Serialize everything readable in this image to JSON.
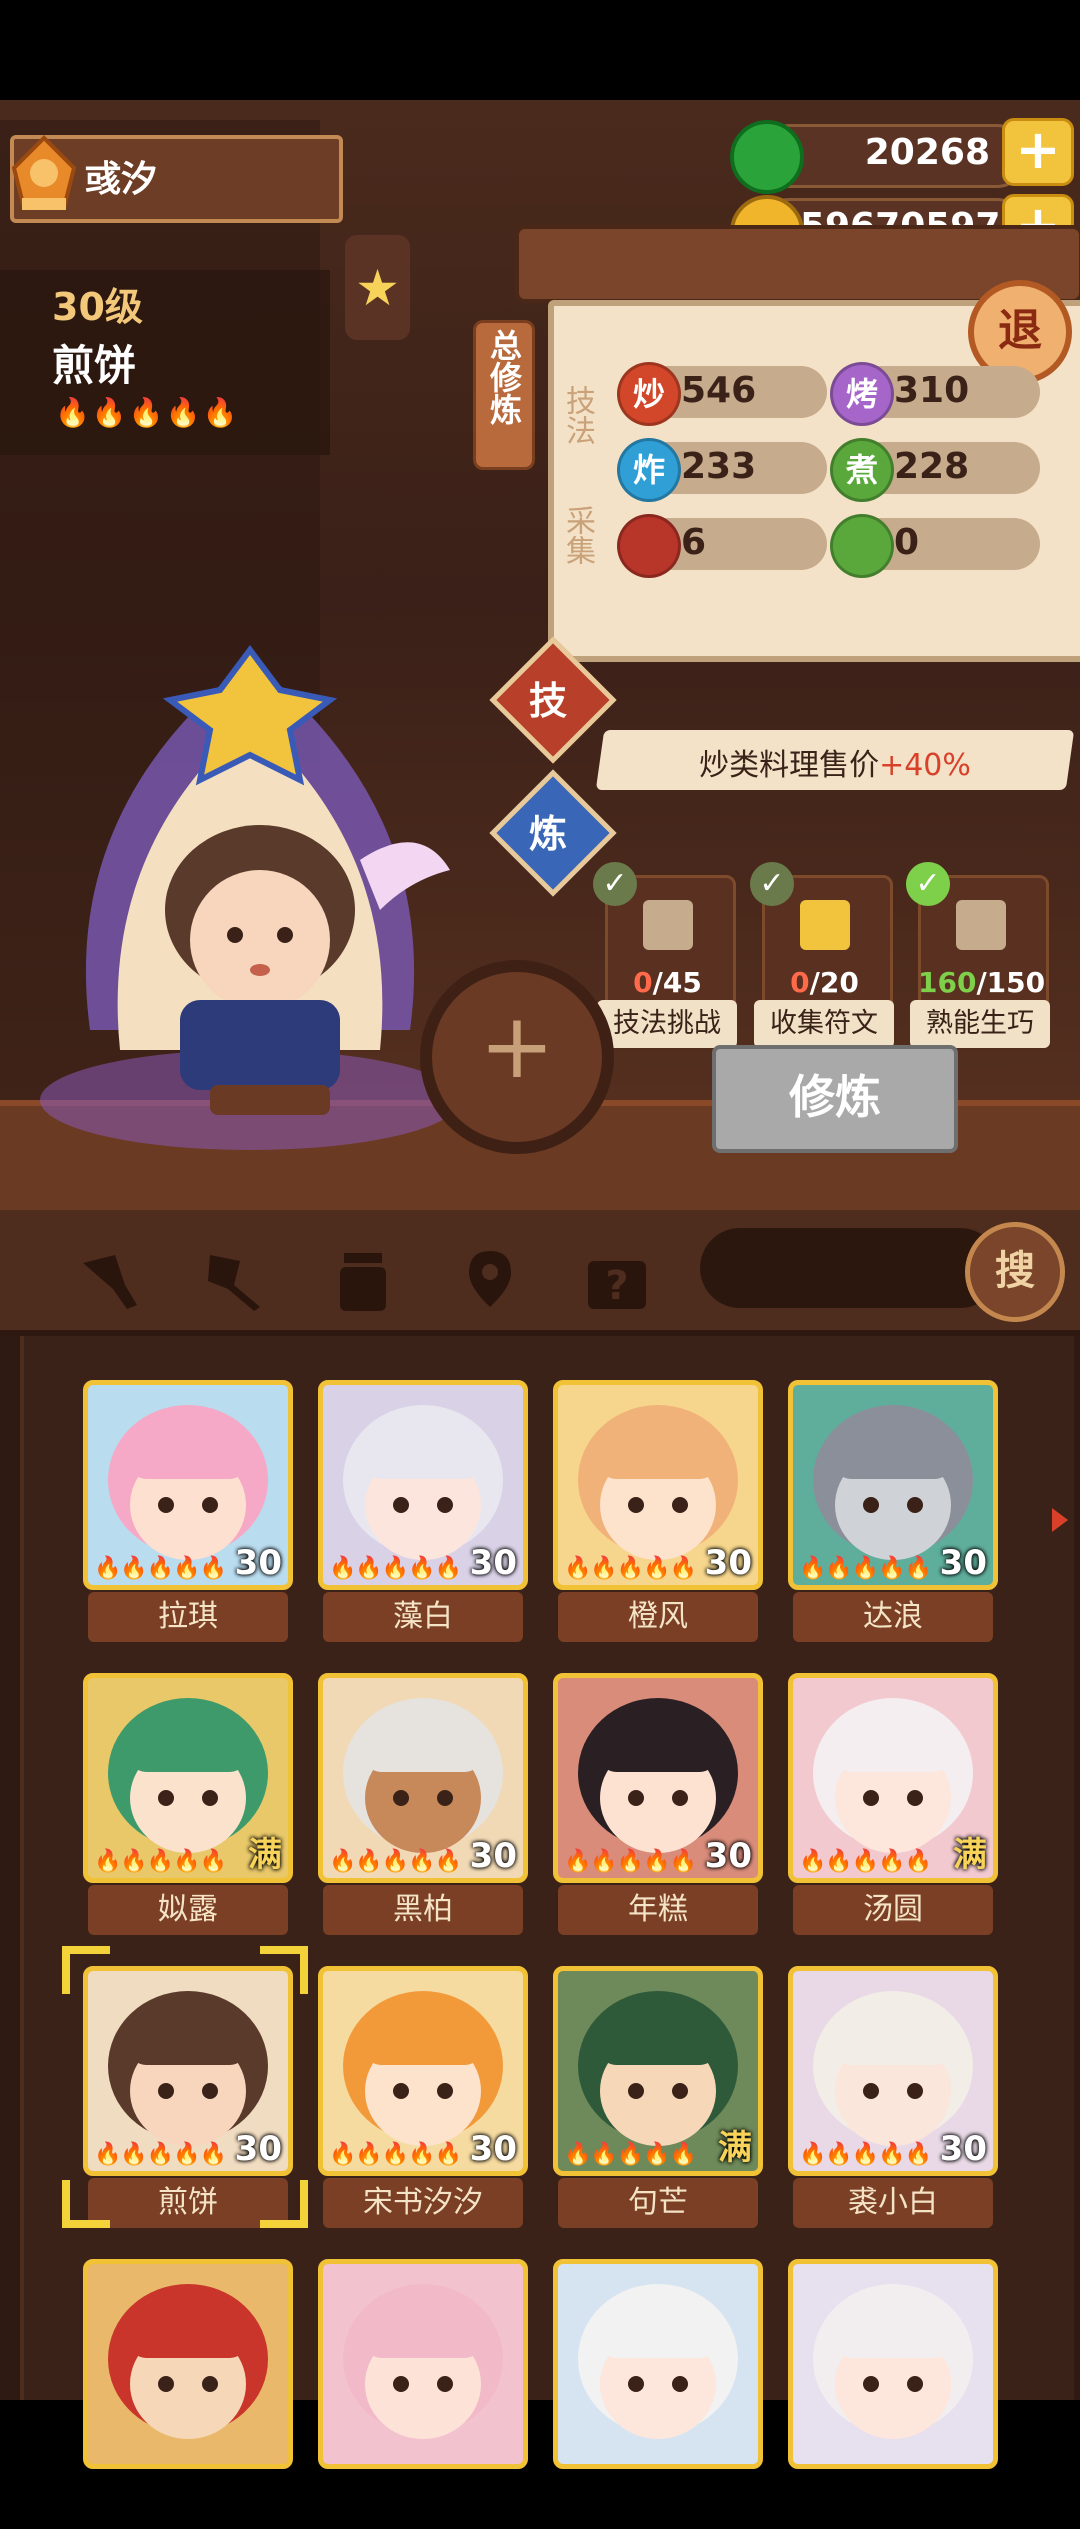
{
  "player": {
    "name": "彧汐"
  },
  "currency": {
    "jade": "20268",
    "coins": "59670597"
  },
  "chef": {
    "level": "30级",
    "name": "煎饼",
    "flames": "🔥🔥🔥🔥🔥"
  },
  "panel": {
    "sign": "总修炼",
    "technique_label": "技法",
    "gather_label": "采集",
    "stats": [
      {
        "icon": "炒",
        "value": "546",
        "color": "#d2472a"
      },
      {
        "icon": "烤",
        "value": "310",
        "color": "#a565c9"
      },
      {
        "icon": "炸",
        "value": "233",
        "color": "#2f9fd6"
      },
      {
        "icon": "煮",
        "value": "228",
        "color": "#5aa83c"
      }
    ],
    "gather": [
      {
        "icon": "meat-icon",
        "value": "6",
        "color": "#b8352a"
      },
      {
        "icon": "vegetable-icon",
        "value": "0",
        "color": "#5aa83c"
      }
    ],
    "exit": "退"
  },
  "tabs": {
    "skill": "技",
    "refine": "炼"
  },
  "bonus": {
    "prefix": "炒类料理售价",
    "highlight": "+40%"
  },
  "tasks": [
    {
      "current": "0",
      "total": "/45",
      "label": "技法挑战"
    },
    {
      "current": "0",
      "total": "/20",
      "label": "收集符文"
    },
    {
      "current": "160",
      "total": "/150",
      "label": "熟能生巧"
    }
  ],
  "cultivate_button": "修炼",
  "search_button": "搜",
  "roster": [
    {
      "name": "拉琪",
      "level": "30",
      "hair": "#f6a9c6",
      "skin": "#fde0d0",
      "bg": "#b9dcef"
    },
    {
      "name": "藻白",
      "level": "30",
      "hair": "#e8e6ef",
      "skin": "#fbe5dc",
      "bg": "#d9d1e6"
    },
    {
      "name": "橙风",
      "level": "30",
      "hair": "#f1b27a",
      "skin": "#fde2cc",
      "bg": "#f6d68c"
    },
    {
      "name": "达浪",
      "level": "30",
      "hair": "#8a8f9a",
      "skin": "#cfd2d6",
      "bg": "#5fae9c"
    },
    {
      "name": "姒露",
      "level": "满",
      "hair": "#3e9a6a",
      "skin": "#fbe2cc",
      "bg": "#e9c86a"
    },
    {
      "name": "黑柏",
      "level": "30",
      "hair": "#e6e2de",
      "skin": "#c8895a",
      "bg": "#f1d9b5"
    },
    {
      "name": "年糕",
      "level": "30",
      "hair": "#2a2024",
      "skin": "#fde2d2",
      "bg": "#d98c7a"
    },
    {
      "name": "汤圆",
      "level": "满",
      "hair": "#f4eef0",
      "skin": "#fde6dc",
      "bg": "#f2c9cf"
    },
    {
      "name": "煎饼",
      "level": "30",
      "hair": "#5a3a2a",
      "skin": "#f7d6bd",
      "bg": "#f0dcc0"
    },
    {
      "name": "宋书汐汐",
      "level": "30",
      "hair": "#f29a3a",
      "skin": "#fde2cc",
      "bg": "#f6dba0"
    },
    {
      "name": "句芒",
      "level": "满",
      "hair": "#2f5a3a",
      "skin": "#f6d8b8",
      "bg": "#6e8a5a"
    },
    {
      "name": "裘小白",
      "level": "30",
      "hair": "#f2ede6",
      "skin": "#fbe6dc",
      "bg": "#e9d9e6"
    },
    {
      "name": "",
      "level": "",
      "hair": "#c9352a",
      "skin": "#f6d8b8",
      "bg": "#e9b86a"
    },
    {
      "name": "",
      "level": "",
      "hair": "#f2b9c9",
      "skin": "#fde2d8",
      "bg": "#f3c2cf"
    },
    {
      "name": "",
      "level": "",
      "hair": "#f2f2f2",
      "skin": "#fde6dc",
      "bg": "#d6e4f2"
    },
    {
      "name": "",
      "level": "",
      "hair": "#f2eef0",
      "skin": "#fde6dc",
      "bg": "#e6e0ef"
    }
  ]
}
